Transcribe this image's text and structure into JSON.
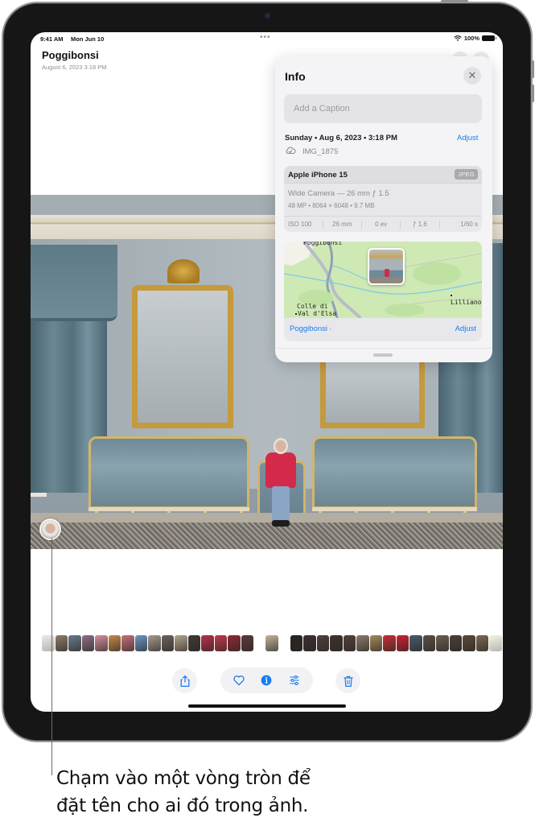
{
  "status_bar": {
    "time": "9:41 AM",
    "date": "Mon Jun 10",
    "battery": "100%"
  },
  "header": {
    "title": "Poggibonsi",
    "subtitle": "August 6, 2023  3:18 PM"
  },
  "info_panel": {
    "title": "Info",
    "close_icon": "close-icon",
    "caption_placeholder": "Add a Caption",
    "caption_value": "",
    "date_line": "Sunday • Aug 6, 2023 • 3:18 PM",
    "adjust_date_label": "Adjust",
    "filename": "IMG_1875",
    "camera": {
      "model": "Apple iPhone 15",
      "format": "JPEG",
      "lens": "Wide Camera — 26 mm ƒ 1.5",
      "file_details": "48 MP  •  8064 × 6048  •  9.7 MB",
      "exif": [
        "ISO 100",
        "26 mm",
        "0 ev",
        "ƒ 1.6",
        "1/60 s"
      ]
    },
    "map": {
      "labels": {
        "top": "Poggibonsi",
        "town1_line1": "Colle di",
        "town1_line2": "Val d'Elsa",
        "town2": "Lilliano"
      },
      "location_label": "Poggibonsi",
      "chevron": "›",
      "adjust_label": "Adjust"
    }
  },
  "filmstrip": {
    "group1_colors": [
      "#d8cfc6",
      "#8c7d6c",
      "#6b7a8c",
      "#8d6f86",
      "#d48ea0",
      "#c58a4a",
      "#c47080",
      "#6a98c8",
      "#a49a8f",
      "#6a6460",
      "#b4a58e",
      "#403a36",
      "#b6304a",
      "#c0384c",
      "#8a2a38",
      "#5a3a3c"
    ],
    "group2_colors": [
      "#c2b49a"
    ],
    "group3_colors": [
      "#2a2420",
      "#3a3030",
      "#50403c",
      "#3e3430",
      "#54403a",
      "#8a7a6a",
      "#a48a5c",
      "#c43038",
      "#d02030",
      "#4a5a70",
      "#5a5048",
      "#6a6050",
      "#4a4038",
      "#5a4a3a",
      "#7a6a54",
      "#e8e4c0"
    ]
  },
  "toolbar": {
    "share": "share-icon",
    "favorite": "heart-icon",
    "info": "info-icon",
    "edit": "adjust-sliders-icon",
    "delete": "trash-icon"
  },
  "callout": {
    "line1": "Chạm vào một vòng tròn để",
    "line2": "đặt tên cho ai đó trong ảnh."
  },
  "colors": {
    "accent": "#1a7cf0",
    "bezel": "#161616",
    "panel_bg": "#f4f4f6"
  }
}
